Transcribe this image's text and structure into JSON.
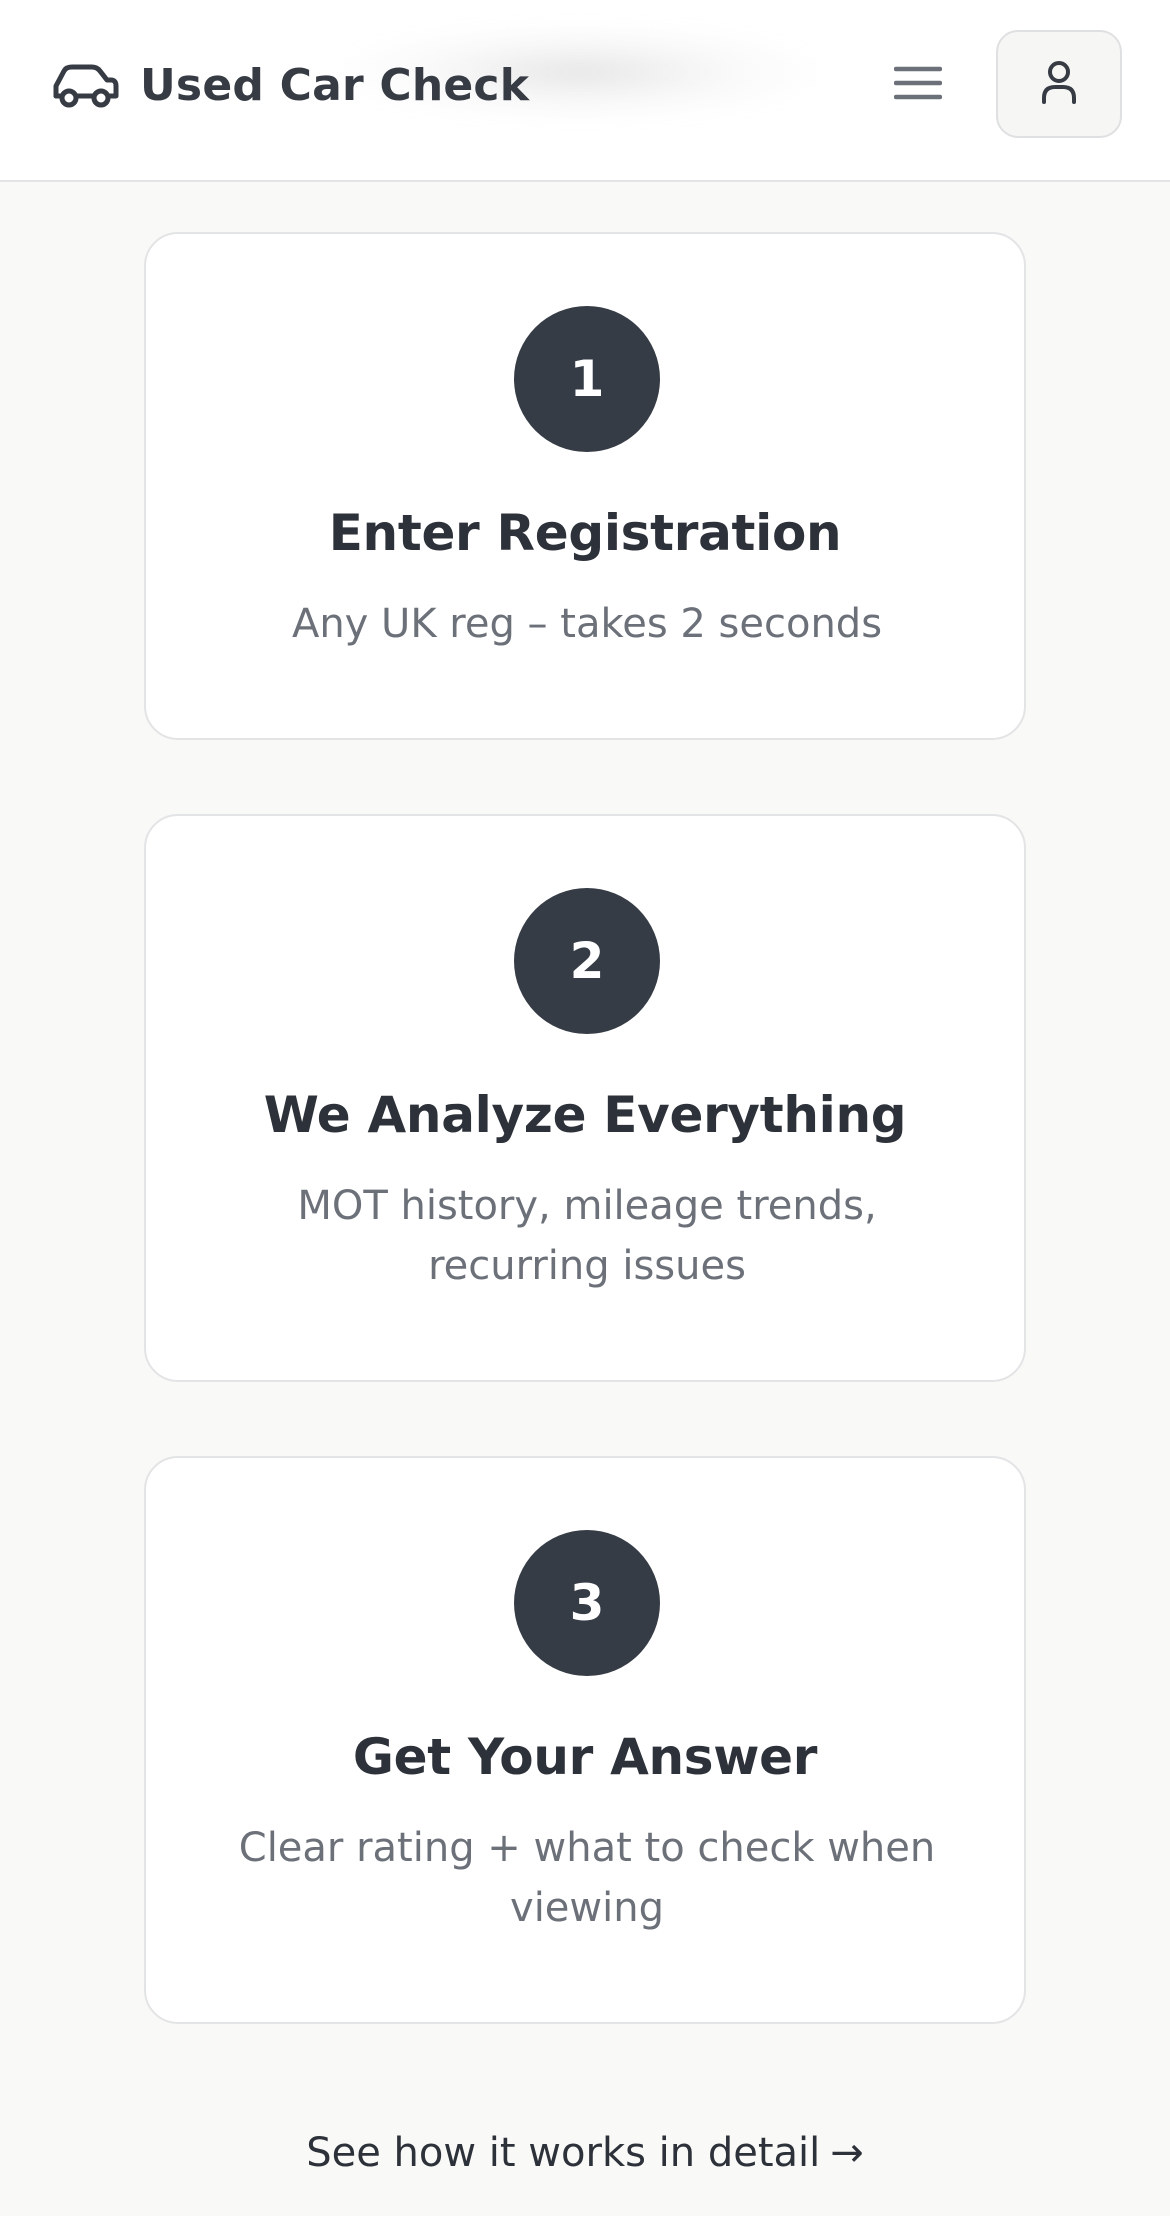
{
  "header": {
    "brand_title": "Used Car Check",
    "brand_icon": "car-icon",
    "menu_icon": "hamburger-menu-icon",
    "account_icon": "user-icon"
  },
  "steps": [
    {
      "number": "1",
      "title": "Enter Registration",
      "description": "Any UK reg – takes 2 seconds"
    },
    {
      "number": "2",
      "title": "We Analyze Everything",
      "description": "MOT history, mileage trends, recurring issues"
    },
    {
      "number": "3",
      "title": "Get Your Answer",
      "description": "Clear rating + what to check when viewing"
    }
  ],
  "detail_link": {
    "label": "See how it works in detail",
    "arrow": "→"
  },
  "colors": {
    "page_background": "#f9f9f7",
    "card_background": "#ffffff",
    "step_circle": "#363c45",
    "heading_text": "#2d3139",
    "muted_text": "#6c7079"
  }
}
